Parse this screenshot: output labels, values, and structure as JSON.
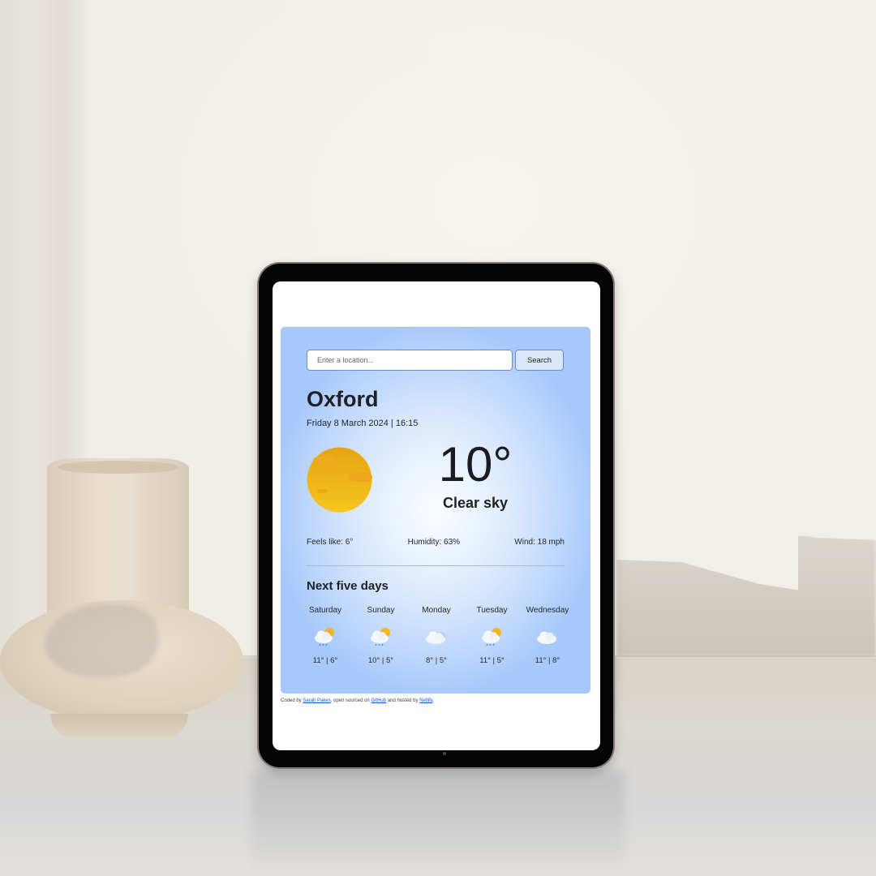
{
  "app": {
    "search": {
      "placeholder": "Enter a location...",
      "value": "",
      "button_label": "Search"
    },
    "current": {
      "city": "Oxford",
      "datetime": "Friday 8 March 2024 | 16:15",
      "icon": "clear-sky-sun-icon",
      "temperature": "10°",
      "condition": "Clear sky",
      "feels_like": "Feels like: 6°",
      "humidity": "Humidity: 63%",
      "wind": "Wind: 18 mph"
    },
    "forecast": {
      "title": "Next five days",
      "days": [
        {
          "name": "Saturday",
          "icon": "sun-cloud-rain-icon",
          "temps": "11° | 6°"
        },
        {
          "name": "Sunday",
          "icon": "sun-cloud-rain-icon",
          "temps": "10° | 5°"
        },
        {
          "name": "Monday",
          "icon": "cloud-icon",
          "temps": "8° | 5°"
        },
        {
          "name": "Tuesday",
          "icon": "sun-cloud-rain-icon",
          "temps": "11° | 5°"
        },
        {
          "name": "Wednesday",
          "icon": "cloud-icon",
          "temps": "11° | 8°"
        }
      ]
    },
    "footer": {
      "prefix": "Coded by ",
      "author_link": "Sarah Pakes",
      "middle": ", open sourced on ",
      "github_link": "GitHub",
      "middle2": " and hosted by ",
      "host_link": "Netlify",
      "suffix": "."
    }
  },
  "colors": {
    "card_edge": "#a7c8fb",
    "card_center": "#fbfdff",
    "link": "#1a55d6",
    "sun": "#f2b31a",
    "tablet_bezel": "#050404"
  }
}
